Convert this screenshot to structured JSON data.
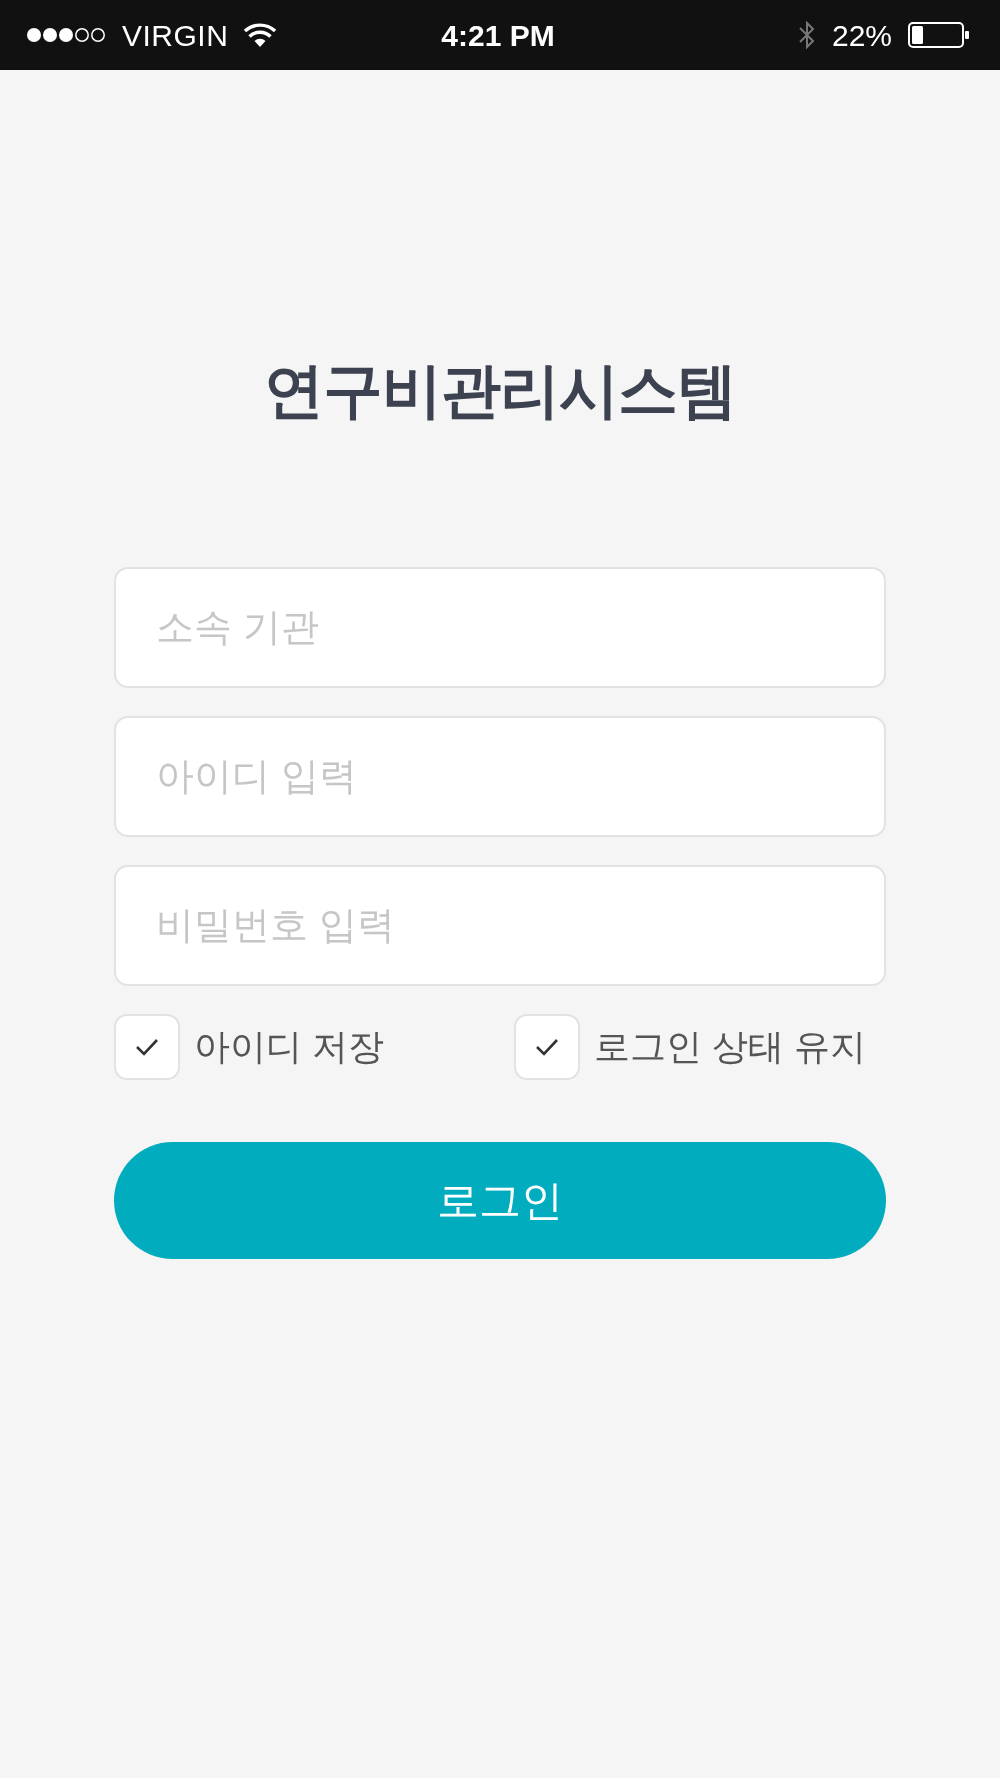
{
  "status_bar": {
    "carrier": "VIRGIN",
    "time": "4:21 PM",
    "battery": "22%"
  },
  "title": "연구비관리시스템",
  "fields": [
    {
      "placeholder": "소속 기관"
    },
    {
      "placeholder": "아이디 입력"
    },
    {
      "placeholder": "비밀번호 입력"
    }
  ],
  "options": [
    {
      "label": "아이디 저장",
      "checked": true
    },
    {
      "label": "로그인 상태 유지",
      "checked": true
    }
  ],
  "login_button": "로그인"
}
